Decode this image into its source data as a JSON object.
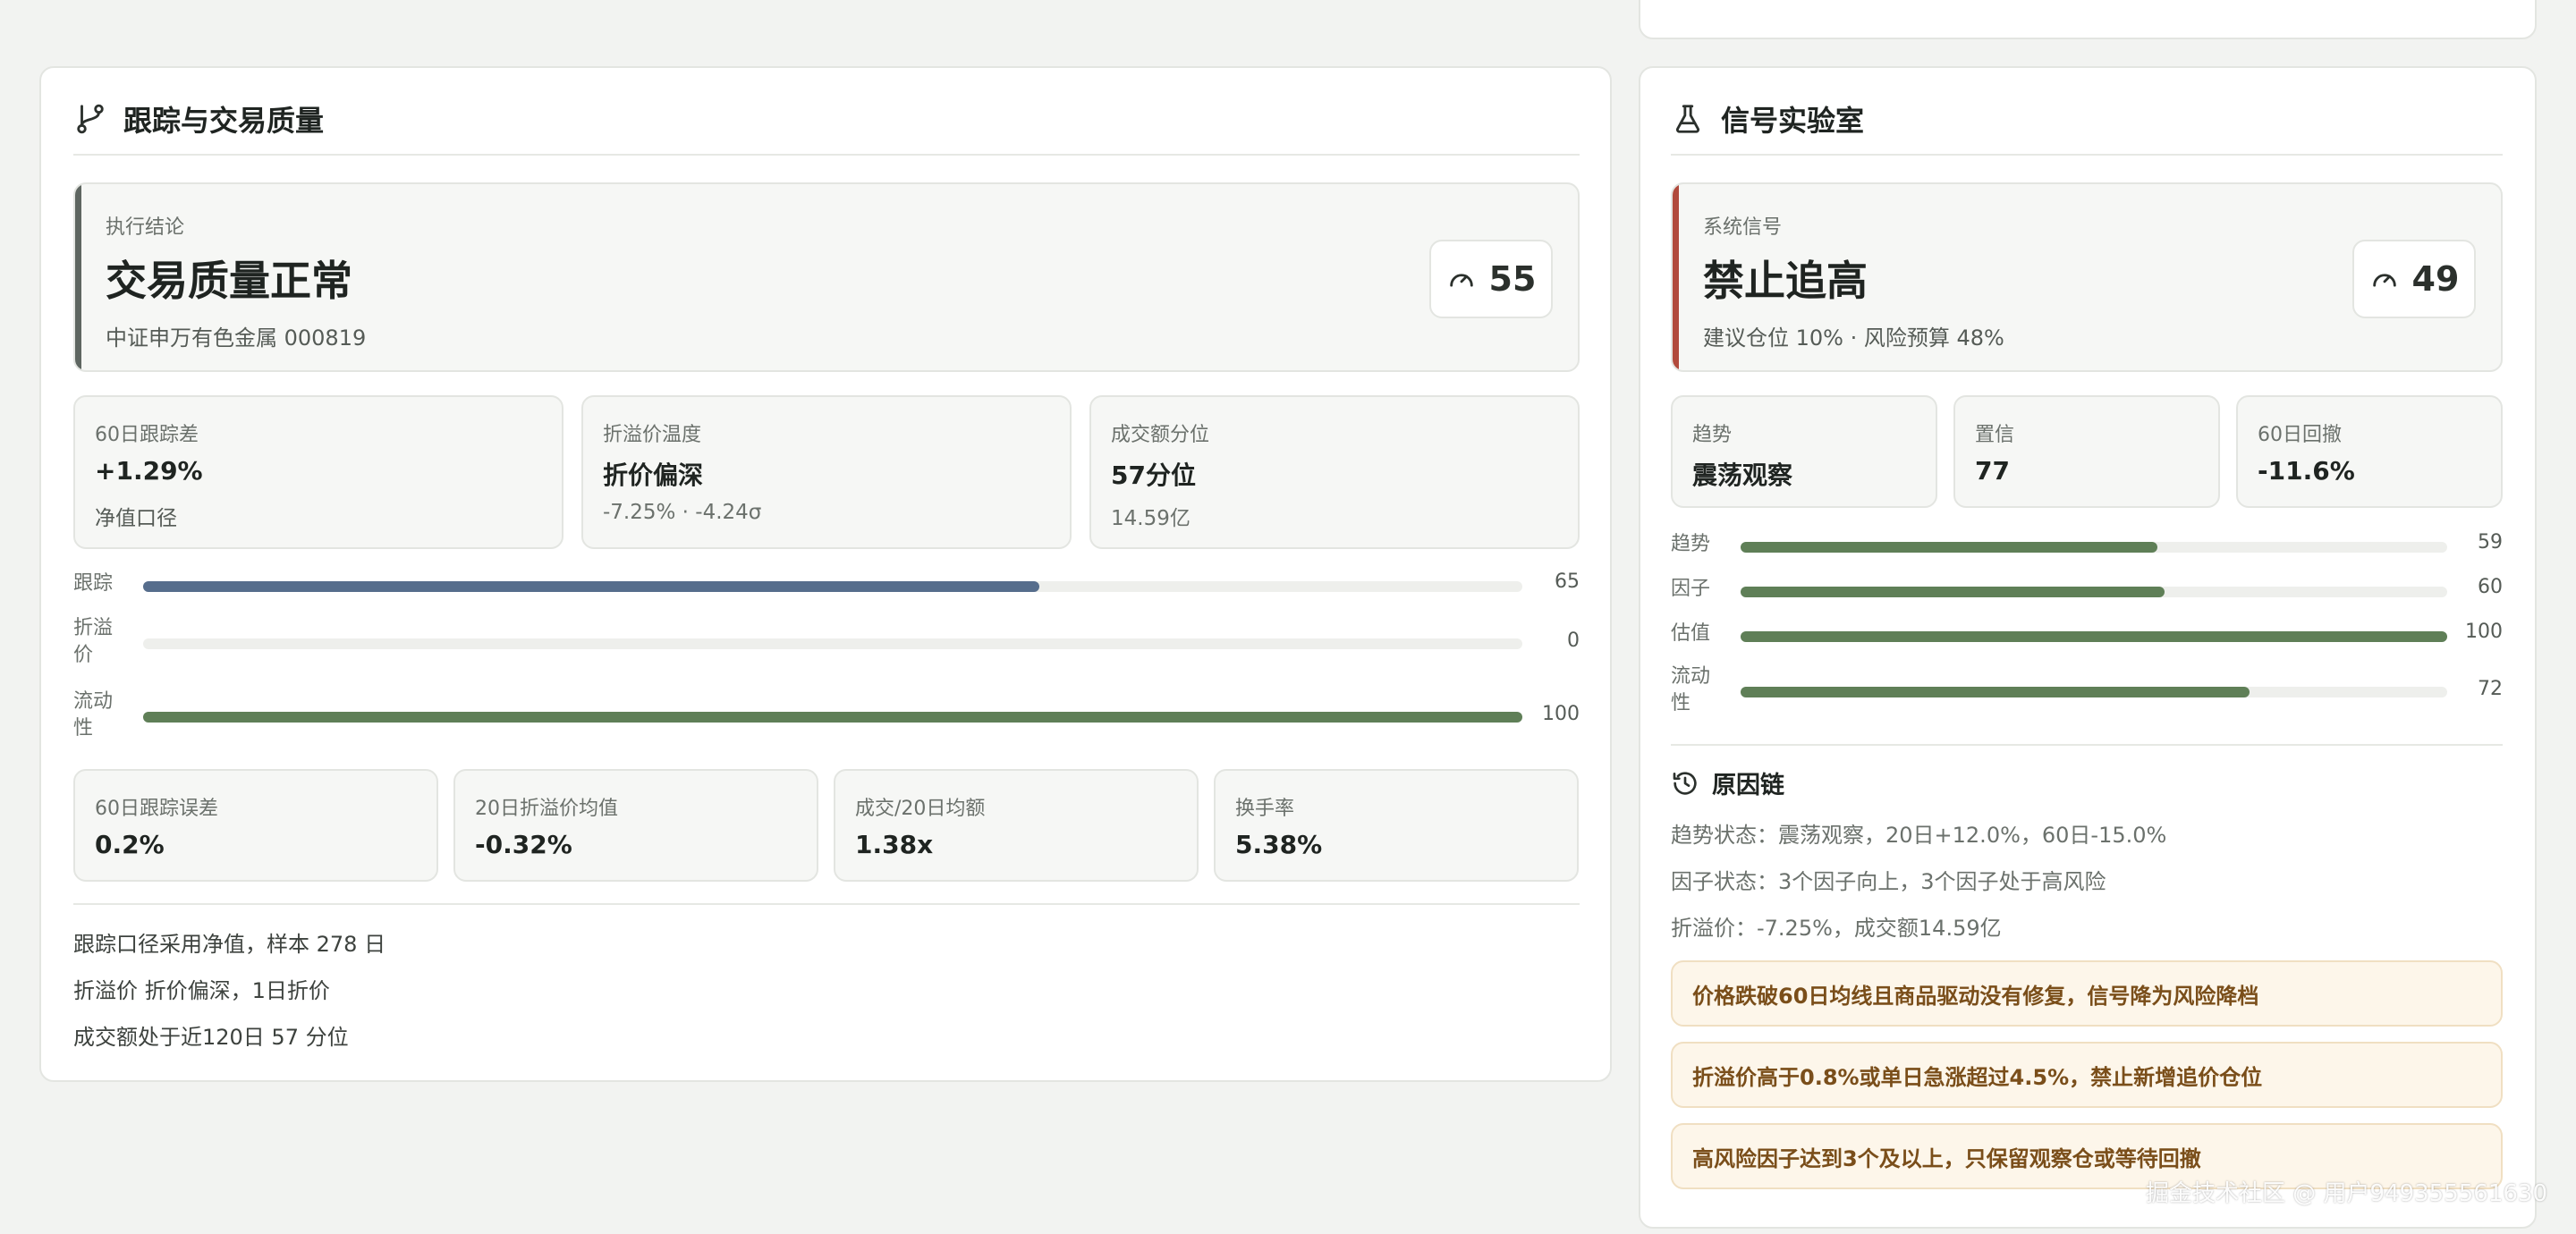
{
  "left_panel": {
    "title": "跟踪与交易质量",
    "icon": "git-branch-icon",
    "hero": {
      "kicker": "执行结论",
      "headline": "交易质量正常",
      "sub": "中证申万有色金属 000819",
      "score": "55",
      "accent_color": "#5e6661"
    },
    "metrics": [
      {
        "label": "60日跟踪差",
        "value": "+1.29%",
        "note": "净值口径"
      },
      {
        "label": "折溢价温度",
        "value": "折价偏深",
        "note": "-7.25% · -4.24σ"
      },
      {
        "label": "成交额分位",
        "value": "57分位",
        "note": "14.59亿"
      }
    ],
    "bars": [
      {
        "label": "跟踪",
        "value": 65,
        "display": "65",
        "color": "#566d8c"
      },
      {
        "label": "折溢价",
        "value": 0,
        "display": "0",
        "color": "#5f7f57"
      },
      {
        "label": "流动性",
        "value": 100,
        "display": "100",
        "color": "#5f7f57"
      }
    ],
    "stats": [
      {
        "label": "60日跟踪误差",
        "value": "0.2%"
      },
      {
        "label": "20日折溢价均值",
        "value": "-0.32%"
      },
      {
        "label": "成交/20日均额",
        "value": "1.38x"
      },
      {
        "label": "换手率",
        "value": "5.38%"
      }
    ],
    "footnotes": [
      "跟踪口径采用净值，样本 278 日",
      "折溢价 折价偏深，1日折价",
      "成交额处于近120日 57 分位"
    ]
  },
  "right_panel": {
    "title": "信号实验室",
    "icon": "flask-icon",
    "hero": {
      "kicker": "系统信号",
      "headline": "禁止追高",
      "sub": "建议仓位 10% · 风险预算 48%",
      "score": "49",
      "accent_color": "#b14a3c"
    },
    "metrics": [
      {
        "label": "趋势",
        "value": "震荡观察"
      },
      {
        "label": "置信",
        "value": "77"
      },
      {
        "label": "60日回撤",
        "value": "-11.6%"
      }
    ],
    "bars": [
      {
        "label": "趋势",
        "value": 59,
        "display": "59",
        "color": "#5f7f57"
      },
      {
        "label": "因子",
        "value": 60,
        "display": "60",
        "color": "#5f7f57"
      },
      {
        "label": "估值",
        "value": 100,
        "display": "100",
        "color": "#5f7f57"
      },
      {
        "label": "流动性",
        "value": 72,
        "display": "72",
        "color": "#5f7f57"
      }
    ],
    "reason_chain": {
      "title": "原因链",
      "icon": "history-icon",
      "lines": [
        "趋势状态：震荡观察，20日+12.0%，60日-15.0%",
        "因子状态：3个因子向上，3个因子处于高风险",
        "折溢价：-7.25%，成交额14.59亿"
      ],
      "warnings": [
        "价格跌破60日均线且商品驱动没有修复，信号降为风险降档",
        "折溢价高于0.8%或单日急涨超过4.5%，禁止新增追价仓位",
        "高风险因子达到3个及以上，只保留观察仓或等待回撤"
      ]
    }
  },
  "watermark": "掘金技术社区 @ 用户949355561630"
}
